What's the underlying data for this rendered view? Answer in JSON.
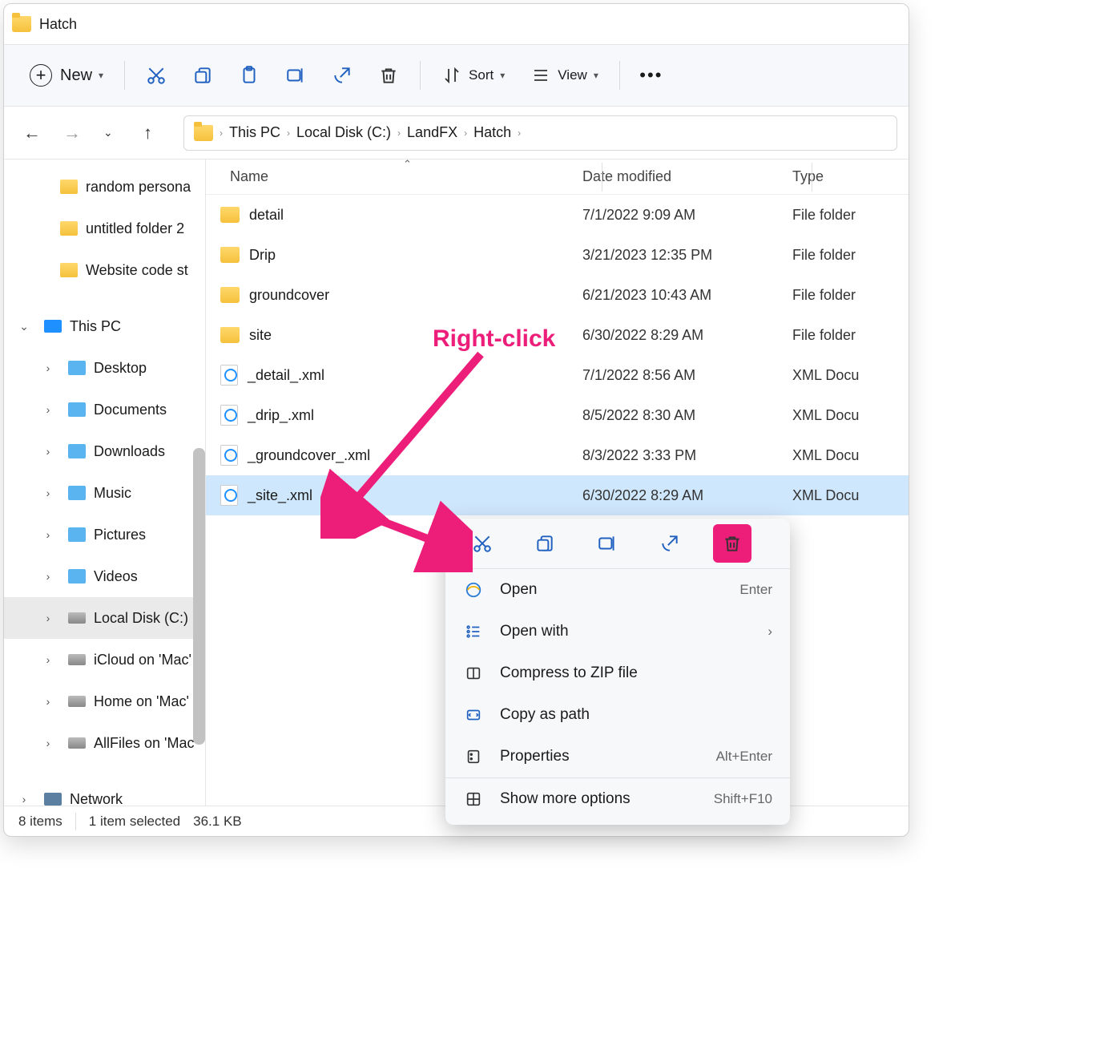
{
  "window_title": "Hatch",
  "toolbar": {
    "new_label": "New",
    "sort_label": "Sort",
    "view_label": "View"
  },
  "breadcrumb": [
    "This PC",
    "Local Disk (C:)",
    "LandFX",
    "Hatch"
  ],
  "sidebar": {
    "quick": [
      "random persona",
      "untitled folder 2",
      "Website code st"
    ],
    "this_pc_label": "This PC",
    "libs": [
      "Desktop",
      "Documents",
      "Downloads",
      "Music",
      "Pictures",
      "Videos",
      "Local Disk (C:)",
      "iCloud on 'Mac'",
      "Home on 'Mac'",
      "AllFiles on 'Mac'"
    ],
    "network_label": "Network"
  },
  "columns": {
    "name": "Name",
    "date": "Date modified",
    "type": "Type"
  },
  "rows": [
    {
      "icon": "folder",
      "name": "detail",
      "date": "7/1/2022 9:09 AM",
      "type": "File folder"
    },
    {
      "icon": "folder",
      "name": "Drip",
      "date": "3/21/2023 12:35 PM",
      "type": "File folder"
    },
    {
      "icon": "folder",
      "name": "groundcover",
      "date": "6/21/2023 10:43 AM",
      "type": "File folder"
    },
    {
      "icon": "folder",
      "name": "site",
      "date": "6/30/2022 8:29 AM",
      "type": "File folder"
    },
    {
      "icon": "xml",
      "name": "_detail_.xml",
      "date": "7/1/2022 8:56 AM",
      "type": "XML Docu"
    },
    {
      "icon": "xml",
      "name": "_drip_.xml",
      "date": "8/5/2022 8:30 AM",
      "type": "XML Docu"
    },
    {
      "icon": "xml",
      "name": "_groundcover_.xml",
      "date": "8/3/2022 3:33 PM",
      "type": "XML Docu"
    },
    {
      "icon": "xml",
      "name": "_site_.xml",
      "date": "6/30/2022 8:29 AM",
      "type": "XML Docu",
      "selected": true
    }
  ],
  "statusbar": {
    "count": "8 items",
    "selection": "1 item selected",
    "size": "36.1 KB"
  },
  "context_menu": {
    "items": [
      {
        "icon": "ie",
        "label": "Open",
        "hint": "Enter"
      },
      {
        "icon": "openwith",
        "label": "Open with",
        "sub": true
      },
      {
        "icon": "zip",
        "label": "Compress to ZIP file"
      },
      {
        "icon": "path",
        "label": "Copy as path"
      },
      {
        "icon": "props",
        "label": "Properties",
        "hint": "Alt+Enter"
      },
      {
        "sep": true
      },
      {
        "icon": "more",
        "label": "Show more options",
        "hint": "Shift+F10"
      }
    ]
  },
  "annotation": {
    "label": "Right-click"
  }
}
